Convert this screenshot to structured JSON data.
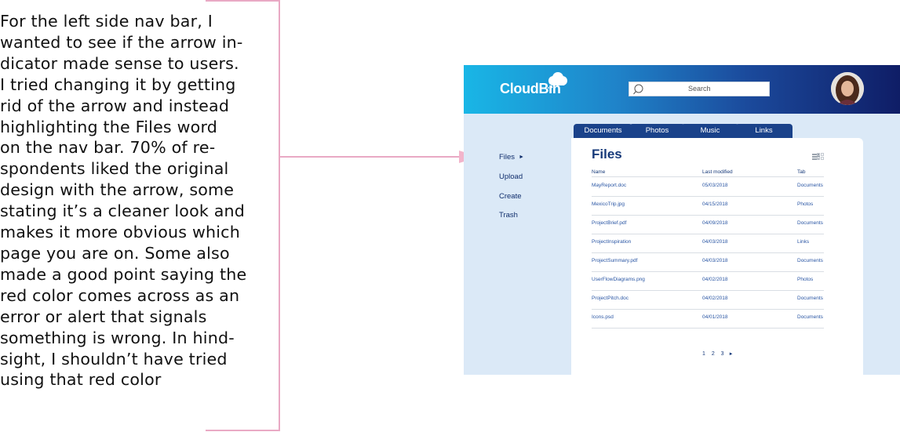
{
  "annotation": {
    "lines": [
      "For the left side nav bar, I",
      "wanted to see if the arrow in-",
      "dicator made sense to users.",
      "I tried changing it by getting",
      "rid of the arrow and instead",
      "highlighting the Files word",
      "on the nav bar. 70% of re-",
      "spondents liked the original",
      "design with the arrow, some",
      "stating it’s a cleaner look and",
      "makes it more obvious which",
      "page you are on. Some also",
      "made a good point saying the",
      "red color comes across as an",
      "error or alert that signals",
      "something is wrong. In hind-",
      "sight, I shouldn’t have tried",
      "using that red color"
    ],
    "accent_color": "#e9a9c4"
  },
  "app": {
    "logo": "CloudBin",
    "search_placeholder": "Search",
    "tabs": [
      "Documents",
      "Photos",
      "Music",
      "Links"
    ],
    "nav": [
      {
        "label": "Files",
        "active": true,
        "indicator": "►"
      },
      {
        "label": "Upload"
      },
      {
        "label": "Create"
      },
      {
        "label": "Trash"
      }
    ],
    "panel": {
      "title": "Files",
      "columns": [
        "Name",
        "Last modified",
        "Tab"
      ],
      "rows": [
        {
          "name": "MayReport.doc",
          "modified": "05/03/2018",
          "tab": "Documents"
        },
        {
          "name": "MexicoTrip.jpg",
          "modified": "04/15/2018",
          "tab": "Photos"
        },
        {
          "name": "ProjectBrief.pdf",
          "modified": "04/09/2018",
          "tab": "Documents"
        },
        {
          "name": "ProjectInspiration",
          "modified": "04/03/2018",
          "tab": "Links"
        },
        {
          "name": "ProjectSummary.pdf",
          "modified": "04/03/2018",
          "tab": "Documents"
        },
        {
          "name": "UserFlowDiagrams.png",
          "modified": "04/02/2018",
          "tab": "Photos"
        },
        {
          "name": "ProjectPitch.doc",
          "modified": "04/02/2018",
          "tab": "Documents"
        },
        {
          "name": "Icons.psd",
          "modified": "04/01/2018",
          "tab": "Documents"
        }
      ],
      "pagination": "1 2 3",
      "pagination_next": "►"
    },
    "colors": {
      "header_gradient_start": "#19b6e6",
      "header_gradient_end": "#0f1d66",
      "tab_bg": "#1a428a",
      "page_bg": "#dbe9f7",
      "text_primary": "#173a7a",
      "link_blue": "#2a56a4"
    },
    "icons": {
      "logo": "cloud-icon",
      "search": "search-icon",
      "view_list": "list-view-icon",
      "view_grid": "grid-view-icon"
    }
  }
}
